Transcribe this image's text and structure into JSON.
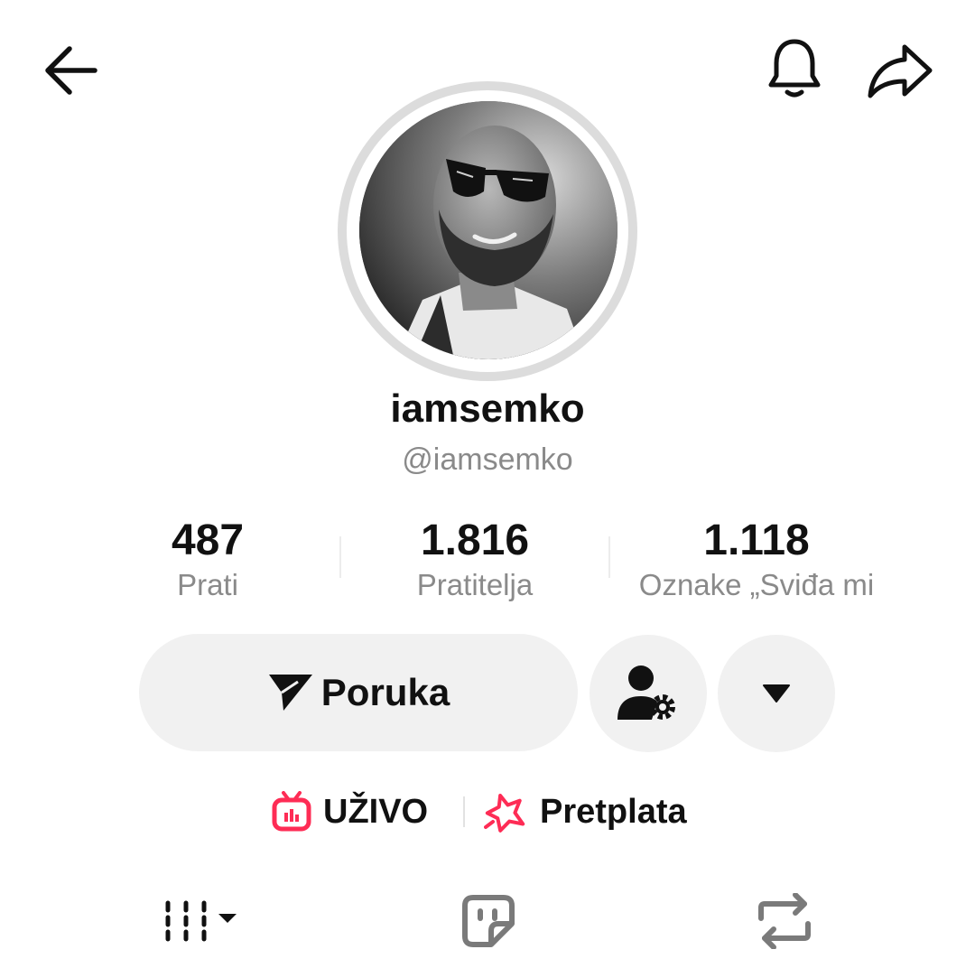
{
  "header": {
    "back_icon": "arrow-left-icon",
    "bell_icon": "bell-icon",
    "share_icon": "share-arrow-icon"
  },
  "profile": {
    "avatar_icon": "profile-photo",
    "display_name": "iamsemko",
    "handle": "@iamsemko"
  },
  "stats": [
    {
      "value": "487",
      "label": "Prati"
    },
    {
      "value": "1.816",
      "label": "Pratitelja"
    },
    {
      "value": "1.118",
      "label": "Oznake „Sviđa mi"
    }
  ],
  "actions": {
    "message_label": "Poruka",
    "message_icon": "send-plane-icon",
    "person_icon": "person-settings-icon",
    "more_icon": "caret-down-icon"
  },
  "links": {
    "live_label": "UŽIVO",
    "live_icon": "tv-live-icon",
    "subscription_label": "Pretplata",
    "subscription_icon": "star-badge-icon",
    "accent_color": "#fe2c55"
  },
  "tabs": [
    {
      "icon": "grid-columns-icon"
    },
    {
      "icon": "tagged-sticker-icon"
    },
    {
      "icon": "repost-icon"
    }
  ]
}
